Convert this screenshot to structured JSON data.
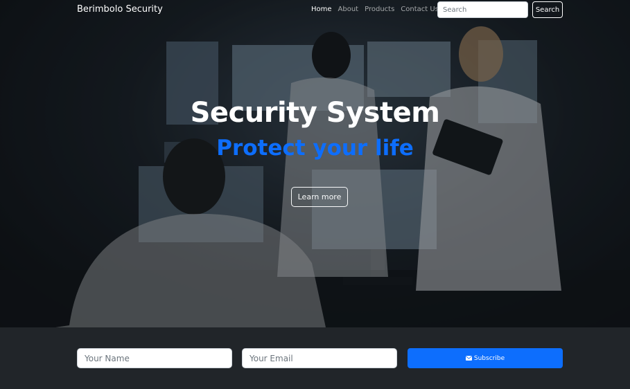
{
  "navbar": {
    "brand": "Berimbolo Security",
    "links": [
      {
        "label": "Home",
        "active": true
      },
      {
        "label": "About",
        "active": false
      },
      {
        "label": "Products",
        "active": false
      },
      {
        "label": "Contact Us",
        "active": false
      }
    ],
    "search": {
      "placeholder": "Search",
      "button_label": "Search"
    }
  },
  "hero": {
    "title": "Security System",
    "subtitle": "Protect your life",
    "button_label": "Learn more",
    "accent_color": "#0d6efd",
    "background_image": "security-control-room-photo"
  },
  "subscribe": {
    "name_placeholder": "Your Name",
    "email_placeholder": "Your Email",
    "button_label": "Subscribe",
    "button_icon": "envelope-icon",
    "button_color": "#0d6efd",
    "background_color": "#212529"
  }
}
